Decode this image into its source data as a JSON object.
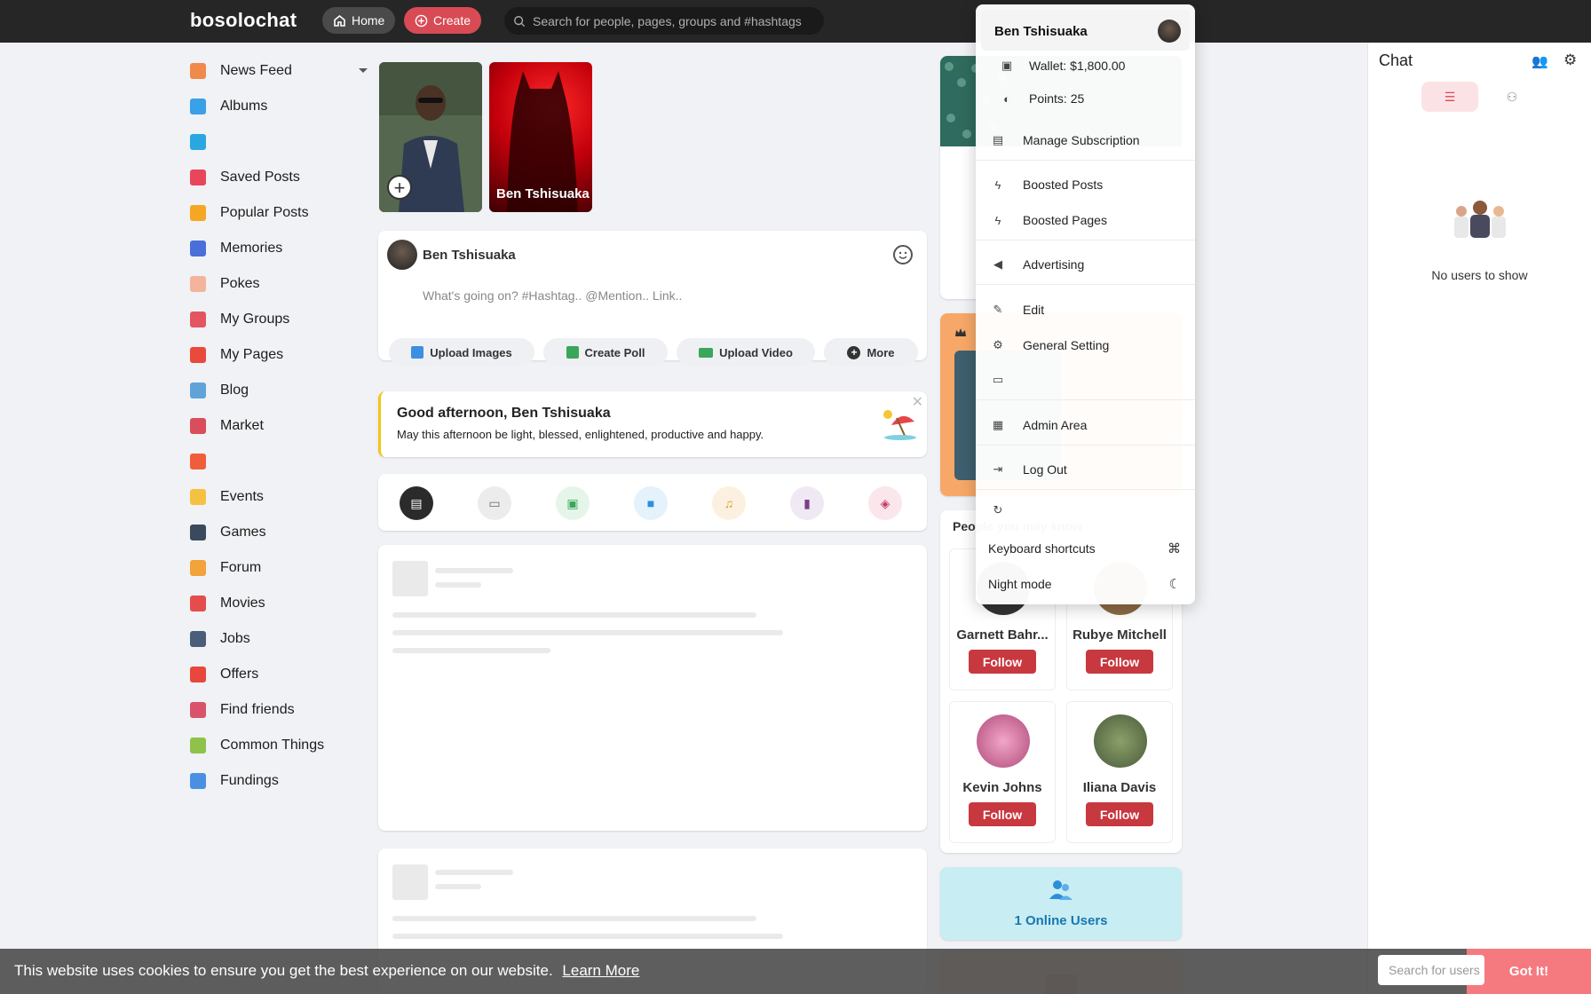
{
  "topbar": {
    "logo": "bosolochat",
    "home_label": "Home",
    "create_label": "Create",
    "search_placeholder": "Search for people, pages, groups and #hashtags"
  },
  "sidebar": {
    "items": [
      {
        "label": "News Feed",
        "icon": "news-feed-icon",
        "color": "#f08a4b"
      },
      {
        "label": "Albums",
        "icon": "albums-icon",
        "color": "#3aa0e8"
      },
      {
        "label": "",
        "icon": "video-icon",
        "color": "#2aa6e0"
      },
      {
        "label": "Saved Posts",
        "icon": "bookmark-icon",
        "color": "#e8465a"
      },
      {
        "label": "Popular Posts",
        "icon": "fire-icon",
        "color": "#f5a623"
      },
      {
        "label": "Memories",
        "icon": "memories-icon",
        "color": "#4a6fd8"
      },
      {
        "label": "Pokes",
        "icon": "poke-icon",
        "color": "#f3b49b"
      },
      {
        "label": "My Groups",
        "icon": "groups-icon",
        "color": "#e3565f"
      },
      {
        "label": "My Pages",
        "icon": "flag-icon",
        "color": "#e84a3c"
      },
      {
        "label": "Blog",
        "icon": "blog-icon",
        "color": "#5fa3d9"
      },
      {
        "label": "Market",
        "icon": "market-icon",
        "color": "#d94d5c"
      },
      {
        "label": "",
        "icon": "apps-icon",
        "color": "#f05d3b"
      },
      {
        "label": "Events",
        "icon": "calendar-icon",
        "color": "#f6c142"
      },
      {
        "label": "Games",
        "icon": "gamepad-icon",
        "color": "#3a4a5e"
      },
      {
        "label": "Forum",
        "icon": "forum-icon",
        "color": "#f2a33a"
      },
      {
        "label": "Movies",
        "icon": "movies-icon",
        "color": "#e54d4d"
      },
      {
        "label": "Jobs",
        "icon": "briefcase-icon",
        "color": "#4a5e7a"
      },
      {
        "label": "Offers",
        "icon": "offers-icon",
        "color": "#e8473e"
      },
      {
        "label": "Find friends",
        "icon": "find-friends-icon",
        "color": "#d9546a"
      },
      {
        "label": "Common Things",
        "icon": "puzzle-icon",
        "color": "#8fc24a"
      },
      {
        "label": "Fundings",
        "icon": "fundings-icon",
        "color": "#4a90e2"
      }
    ]
  },
  "stories": [
    {
      "name": ""
    },
    {
      "name": "Ben Tshisuaka"
    }
  ],
  "publisher": {
    "user": "Ben Tshisuaka",
    "placeholder": "What's going on? #Hashtag.. @Mention.. Link..",
    "buttons": [
      "Upload Images",
      "Create Poll",
      "Upload Video",
      "More"
    ]
  },
  "greeting": {
    "title": "Good afternoon, Ben Tshisuaka",
    "message": "May this afternoon be light, blessed, enlightened, productive and happy."
  },
  "people": {
    "title": "People you may know",
    "list": [
      {
        "name": "Garnett Bahr...",
        "follow": "Follow"
      },
      {
        "name": "Rubye Mitchell",
        "follow": "Follow"
      },
      {
        "name": "Kevin Johns",
        "follow": "Follow"
      },
      {
        "name": "Iliana Davis",
        "follow": "Follow"
      }
    ]
  },
  "online": {
    "label": "1 Online Users"
  },
  "chat": {
    "title": "Chat",
    "empty": "No users to show",
    "search_placeholder": "Search for users"
  },
  "dropdown": {
    "name": "Ben Tshisuaka",
    "wallet": "Wallet: $1,800.00",
    "points": "Points: 25",
    "manage_subscription": "Manage Subscription",
    "boosted_posts": "Boosted Posts",
    "boosted_pages": "Boosted Pages",
    "advertising": "Advertising",
    "edit": "Edit",
    "general_setting": "General Setting",
    "admin_area": "Admin Area",
    "logout": "Log Out",
    "keyboard_shortcuts": "Keyboard shortcuts",
    "night_mode": "Night mode"
  },
  "cookie": {
    "text": "This website uses cookies to ensure you get the best experience on our website.",
    "link": "Learn More",
    "button": "Got It!"
  },
  "colors": {
    "topbar": "#262626",
    "accent": "#d84b55",
    "follow": "#c8383f",
    "online_bg": "#c8edf2"
  }
}
